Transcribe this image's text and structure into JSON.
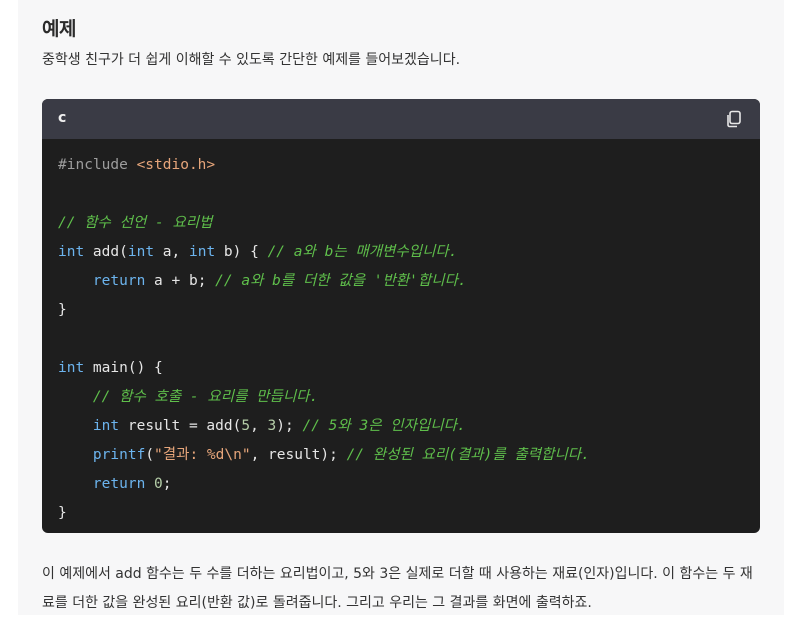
{
  "section": {
    "heading": "예제",
    "intro": "중학생 친구가 더 쉽게 이해할 수 있도록 간단한 예제를 들어보겠습니다."
  },
  "code_block": {
    "language": "c",
    "copy_icon": "copy-icon",
    "lines": [
      [
        {
          "t": "#include ",
          "c": "inc"
        },
        {
          "t": "<stdio.h>",
          "c": "hdr"
        }
      ],
      [],
      [
        {
          "t": "// 함수 선언 - 요리법",
          "c": "cm"
        }
      ],
      [
        {
          "t": "int",
          "c": "kw"
        },
        {
          "t": " add(",
          "c": ""
        },
        {
          "t": "int",
          "c": "kw"
        },
        {
          "t": " a, ",
          "c": ""
        },
        {
          "t": "int",
          "c": "kw"
        },
        {
          "t": " b) { ",
          "c": ""
        },
        {
          "t": "// a와 b는 매개변수입니다.",
          "c": "cm"
        }
      ],
      [
        {
          "t": "    ",
          "c": ""
        },
        {
          "t": "return",
          "c": "kw"
        },
        {
          "t": " a + b; ",
          "c": ""
        },
        {
          "t": "// a와 b를 더한 값을 '반환'합니다.",
          "c": "cm"
        }
      ],
      [
        {
          "t": "}",
          "c": ""
        }
      ],
      [],
      [
        {
          "t": "int",
          "c": "kw"
        },
        {
          "t": " main() {",
          "c": ""
        }
      ],
      [
        {
          "t": "    ",
          "c": ""
        },
        {
          "t": "// 함수 호출 - 요리를 만듭니다.",
          "c": "cm"
        }
      ],
      [
        {
          "t": "    ",
          "c": ""
        },
        {
          "t": "int",
          "c": "kw"
        },
        {
          "t": " result = add(",
          "c": ""
        },
        {
          "t": "5",
          "c": "num"
        },
        {
          "t": ", ",
          "c": ""
        },
        {
          "t": "3",
          "c": "num"
        },
        {
          "t": "); ",
          "c": ""
        },
        {
          "t": "// 5와 3은 인자입니다.",
          "c": "cm"
        }
      ],
      [
        {
          "t": "    ",
          "c": ""
        },
        {
          "t": "printf",
          "c": "kw"
        },
        {
          "t": "(",
          "c": ""
        },
        {
          "t": "\"결과: %d\\n\"",
          "c": "str"
        },
        {
          "t": ", result); ",
          "c": ""
        },
        {
          "t": "// 완성된 요리(결과)를 출력합니다.",
          "c": "cm"
        }
      ],
      [
        {
          "t": "    ",
          "c": ""
        },
        {
          "t": "return",
          "c": "kw"
        },
        {
          "t": " ",
          "c": ""
        },
        {
          "t": "0",
          "c": "num"
        },
        {
          "t": ";",
          "c": ""
        }
      ],
      [
        {
          "t": "}",
          "c": ""
        }
      ]
    ]
  },
  "outro": "이 예제에서 add 함수는 두 수를 더하는 요리법이고, 5와 3은 실제로 더할 때 사용하는 재료(인자)입니다. 이 함수는 두 재료를 더한 값을 완성된 요리(반환 값)로 돌려줍니다. 그리고 우리는 그 결과를 화면에 출력하죠."
}
